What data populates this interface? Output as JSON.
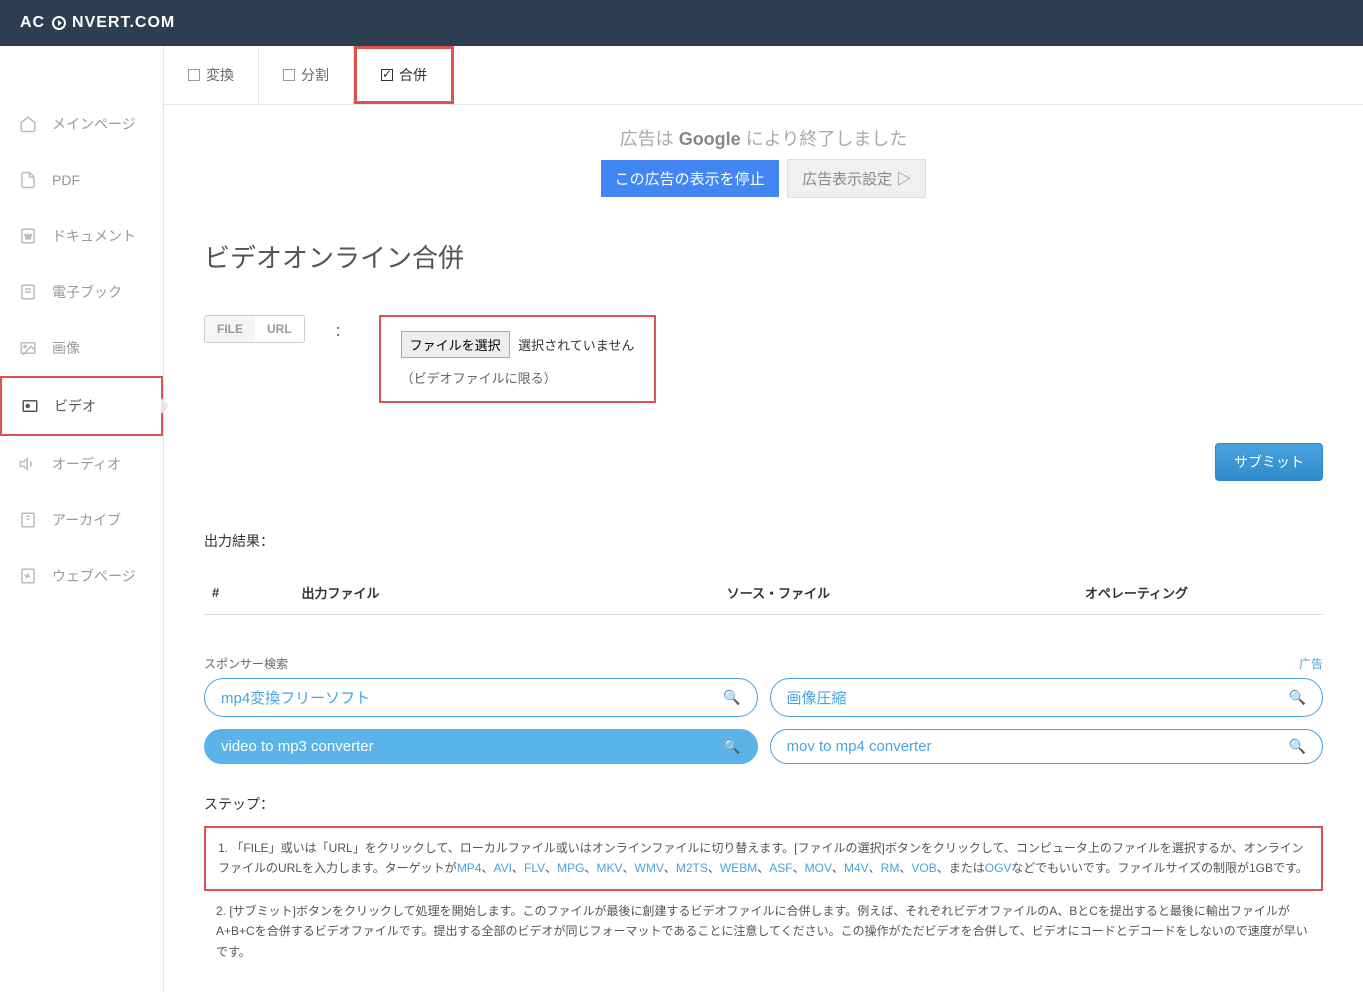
{
  "header": {
    "brand_prefix": "AC",
    "brand_suffix": "NVERT.COM"
  },
  "sidebar": {
    "items": [
      {
        "label": "メインページ"
      },
      {
        "label": "PDF"
      },
      {
        "label": "ドキュメント"
      },
      {
        "label": "電子ブック"
      },
      {
        "label": "画像"
      },
      {
        "label": "ビデオ"
      },
      {
        "label": "オーディオ"
      },
      {
        "label": "アーカイブ"
      },
      {
        "label": "ウェブページ"
      }
    ]
  },
  "tabs": {
    "convert": "変換",
    "split": "分割",
    "merge": "合併"
  },
  "ad": {
    "text_prefix": "広告は ",
    "google": "Google",
    "text_suffix": " により終了しました",
    "stop_btn": "この広告の表示を停止",
    "settings_btn": "広告表示設定 ▷"
  },
  "page": {
    "title": "ビデオオンライン合併",
    "file_tab": "FILE",
    "url_tab": "URL",
    "colon": "：",
    "choose_file_btn": "ファイルを選択",
    "no_file_selected": "選択されていません",
    "file_note": "（ビデオファイルに限る）",
    "submit_btn": "サブミット",
    "output_label": "出力結果："
  },
  "table": {
    "col_num": "#",
    "col_output": "出力ファイル",
    "col_source": "ソース・ファイル",
    "col_operating": "オペレーティング"
  },
  "sponsor": {
    "header": "スポンサー検索",
    "ad_label": "广告",
    "items": [
      {
        "label": "mp4変換フリーソフト",
        "filled": false
      },
      {
        "label": "画像圧縮",
        "filled": false
      },
      {
        "label": "video to mp3 converter",
        "filled": true
      },
      {
        "label": "mov to mp4 converter",
        "filled": false
      }
    ]
  },
  "steps": {
    "title": "ステップ：",
    "step1_prefix": "1. 「FILE」或いは「URL」をクリックして、ローカルファイル或いはオンラインファイルに切り替えます。[ファイルの選択]ボタンをクリックして、コンピュータ上のファイルを選択するか、オンラインファイルのURLを入力します。ターゲットが",
    "formats": [
      "MP4",
      "AVI",
      "FLV",
      "MPG",
      "MKV",
      "WMV",
      "M2TS",
      "WEBM",
      "ASF",
      "MOV",
      "M4V",
      "RM",
      "VOB"
    ],
    "sep": "、",
    "or": "または",
    "ogv": "OGV",
    "step1_suffix": "などでもいいです。ファイルサイズの制限が1GBです。",
    "step2": "2. [サブミット]ボタンをクリックして処理を開始します。このファイルが最後に創建するビデオファイルに合併します。例えば、それぞれビデオファイルのA、BとCを提出すると最後に輸出ファイルがA+B+Cを合併するビデオファイルです。提出する全部のビデオが同じフォーマットであることに注意してください。この操作がただビデオを合併して、ビデオにコードとデコードをしないので速度が早いです。"
  }
}
